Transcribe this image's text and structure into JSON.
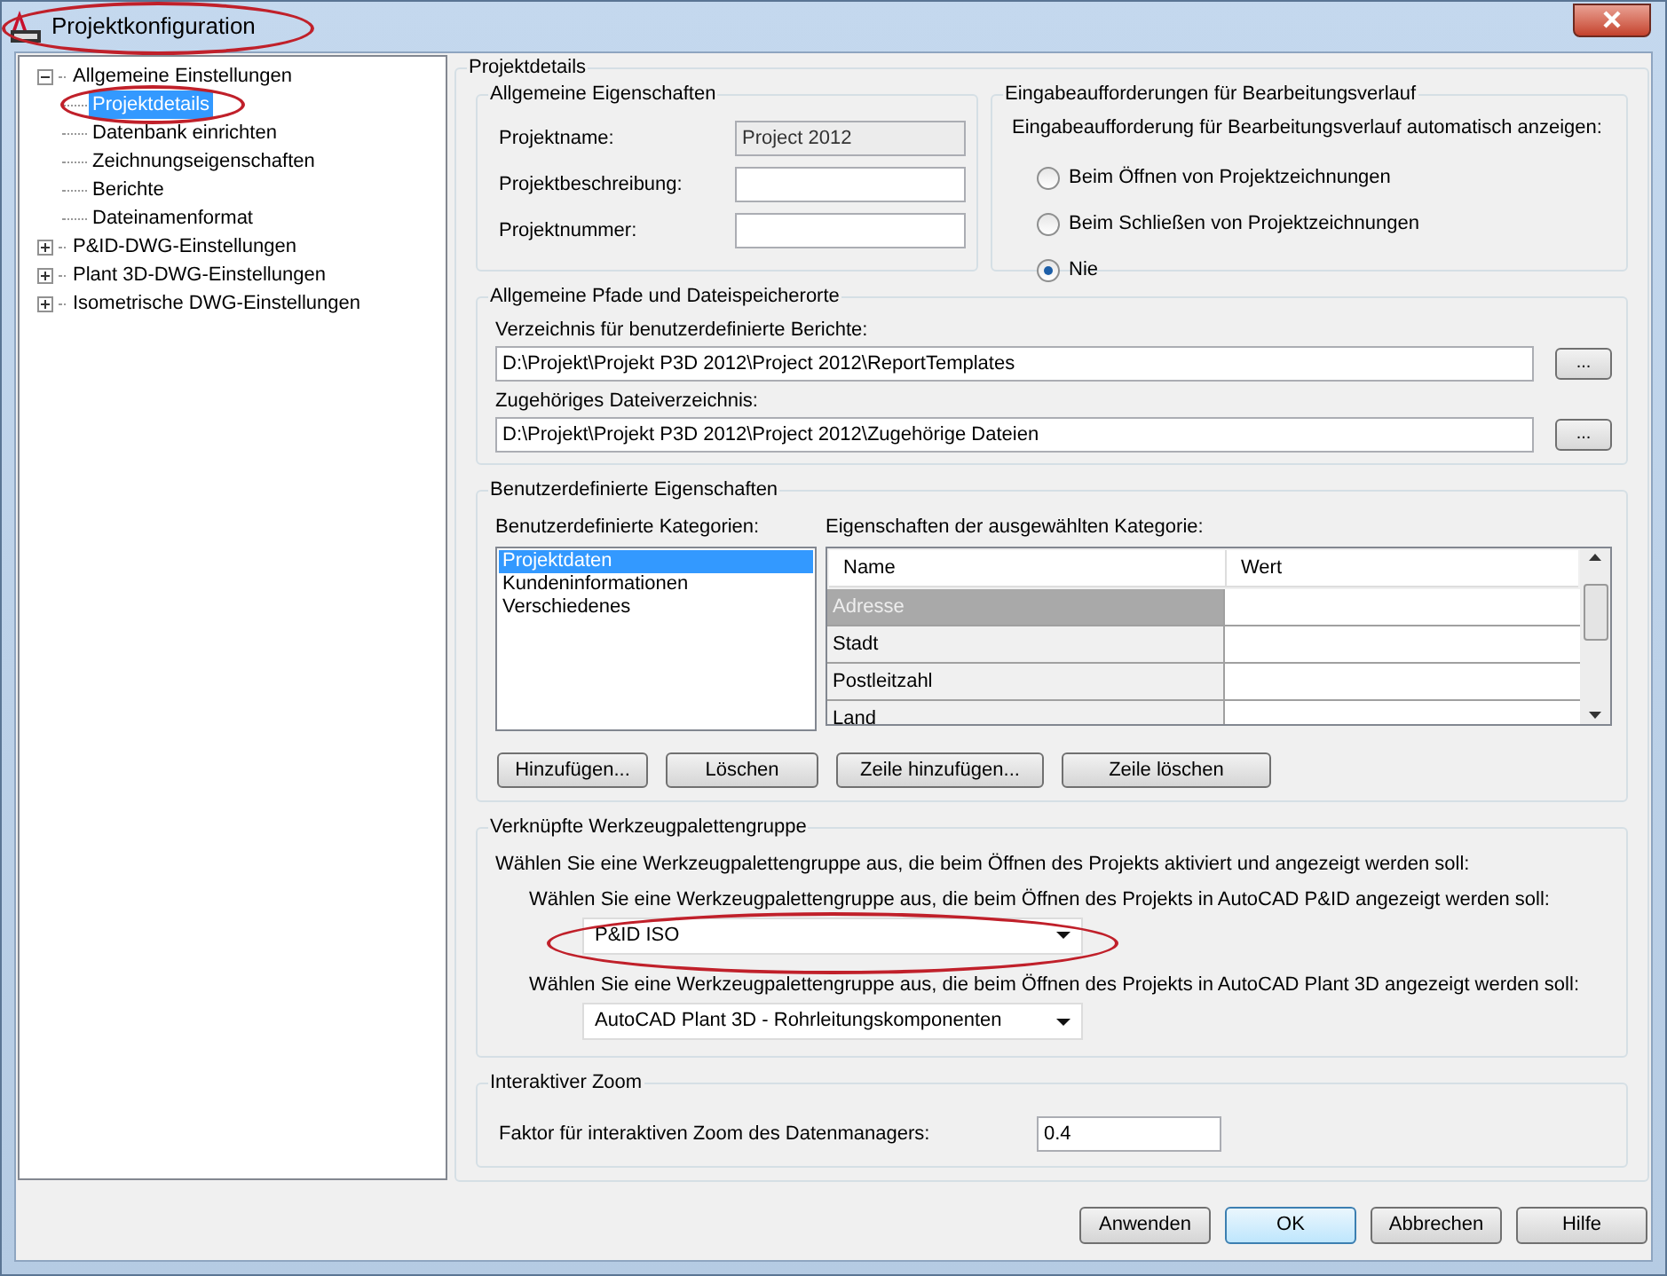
{
  "window": {
    "title": "Projektkonfiguration"
  },
  "tree": [
    {
      "label": "Allgemeine Einstellungen",
      "expanded": true,
      "selected": false,
      "children": [
        {
          "label": "Projektdetails",
          "selected": true
        },
        {
          "label": "Datenbank einrichten",
          "selected": false
        },
        {
          "label": "Zeichnungseigenschaften",
          "selected": false
        },
        {
          "label": "Berichte",
          "selected": false
        },
        {
          "label": "Dateinamenformat",
          "selected": false
        }
      ]
    },
    {
      "label": "P&ID-DWG-Einstellungen",
      "expanded": false,
      "selected": false
    },
    {
      "label": "Plant 3D-DWG-Einstellungen",
      "expanded": false,
      "selected": false
    },
    {
      "label": "Isometrische DWG-Einstellungen",
      "expanded": false,
      "selected": false
    }
  ],
  "page_title": "Projektdetails",
  "general": {
    "title": "Allgemeine Eigenschaften",
    "fields": [
      {
        "label": "Projektname:",
        "value": "Project 2012",
        "disabled": true
      },
      {
        "label": "Projektbeschreibung:",
        "disabled": false
      },
      {
        "label": "Projektnummer:",
        "disabled": false
      }
    ]
  },
  "history": {
    "title": "Eingabeaufforderungen für Bearbeitungsverlauf",
    "prompt": "Eingabeaufforderung für Bearbeitungsverlauf automatisch anzeigen:",
    "options": [
      {
        "label": "Beim Öffnen von Projektzeichnungen",
        "selected": false
      },
      {
        "label": "Beim Schließen von Projektzeichnungen",
        "selected": false
      },
      {
        "label": "Nie",
        "selected": true
      }
    ]
  },
  "paths": {
    "title": "Allgemeine Pfade und Dateispeicherorte",
    "items": [
      {
        "label": "Verzeichnis für benutzerdefinierte Berichte:",
        "value": "D:\\Projekt\\Projekt P3D 2012\\Project 2012\\ReportTemplates",
        "browse": "..."
      },
      {
        "label": "Zugehöriges Dateiverzeichnis:",
        "value": "D:\\Projekt\\Projekt P3D 2012\\Project 2012\\Zugehörige Dateien",
        "browse": "..."
      }
    ]
  },
  "custom": {
    "title": "Benutzerdefinierte Eigenschaften",
    "categories_label": "Benutzerdefinierte Kategorien:",
    "categories": [
      {
        "label": "Projektdaten",
        "selected": true
      },
      {
        "label": "Kundeninformationen",
        "selected": false
      },
      {
        "label": "Verschiedenes",
        "selected": false
      }
    ],
    "properties_label": "Eigenschaften der ausgewählten Kategorie:",
    "columns": [
      "Name",
      "Wert"
    ],
    "rows": [
      {
        "name": "Adresse",
        "selected": true
      },
      {
        "name": "Stadt",
        "selected": false
      },
      {
        "name": "Postleitzahl",
        "selected": false
      },
      {
        "name": "Land",
        "selected": false
      }
    ],
    "buttons": [
      "Hinzufügen...",
      "Löschen",
      "Zeile hinzufügen...",
      "Zeile löschen"
    ]
  },
  "palettes": {
    "title": "Verknüpfte Werkzeugpalettengruppe",
    "intro": "Wählen Sie eine Werkzeugpalettengruppe aus, die beim Öffnen des Projekts aktiviert und angezeigt werden soll:",
    "items": [
      {
        "label": "Wählen Sie eine Werkzeugpalettengruppe aus, die beim Öffnen des Projekts in AutoCAD P&ID angezeigt werden soll:",
        "value": "P&ID ISO"
      },
      {
        "label": "Wählen Sie eine Werkzeugpalettengruppe aus, die beim Öffnen des Projekts in AutoCAD Plant 3D angezeigt werden soll:",
        "value": "AutoCAD Plant 3D - Rohrleitungskomponenten"
      }
    ]
  },
  "zoom": {
    "title": "Interaktiver Zoom",
    "label": "Faktor für interaktiven Zoom des Datenmanagers:",
    "value": "0.4"
  },
  "buttons": [
    {
      "label": "Anwenden",
      "default": false
    },
    {
      "label": "OK",
      "default": true
    },
    {
      "label": "Abbrechen",
      "default": false
    },
    {
      "label": "Hilfe",
      "default": false
    }
  ]
}
